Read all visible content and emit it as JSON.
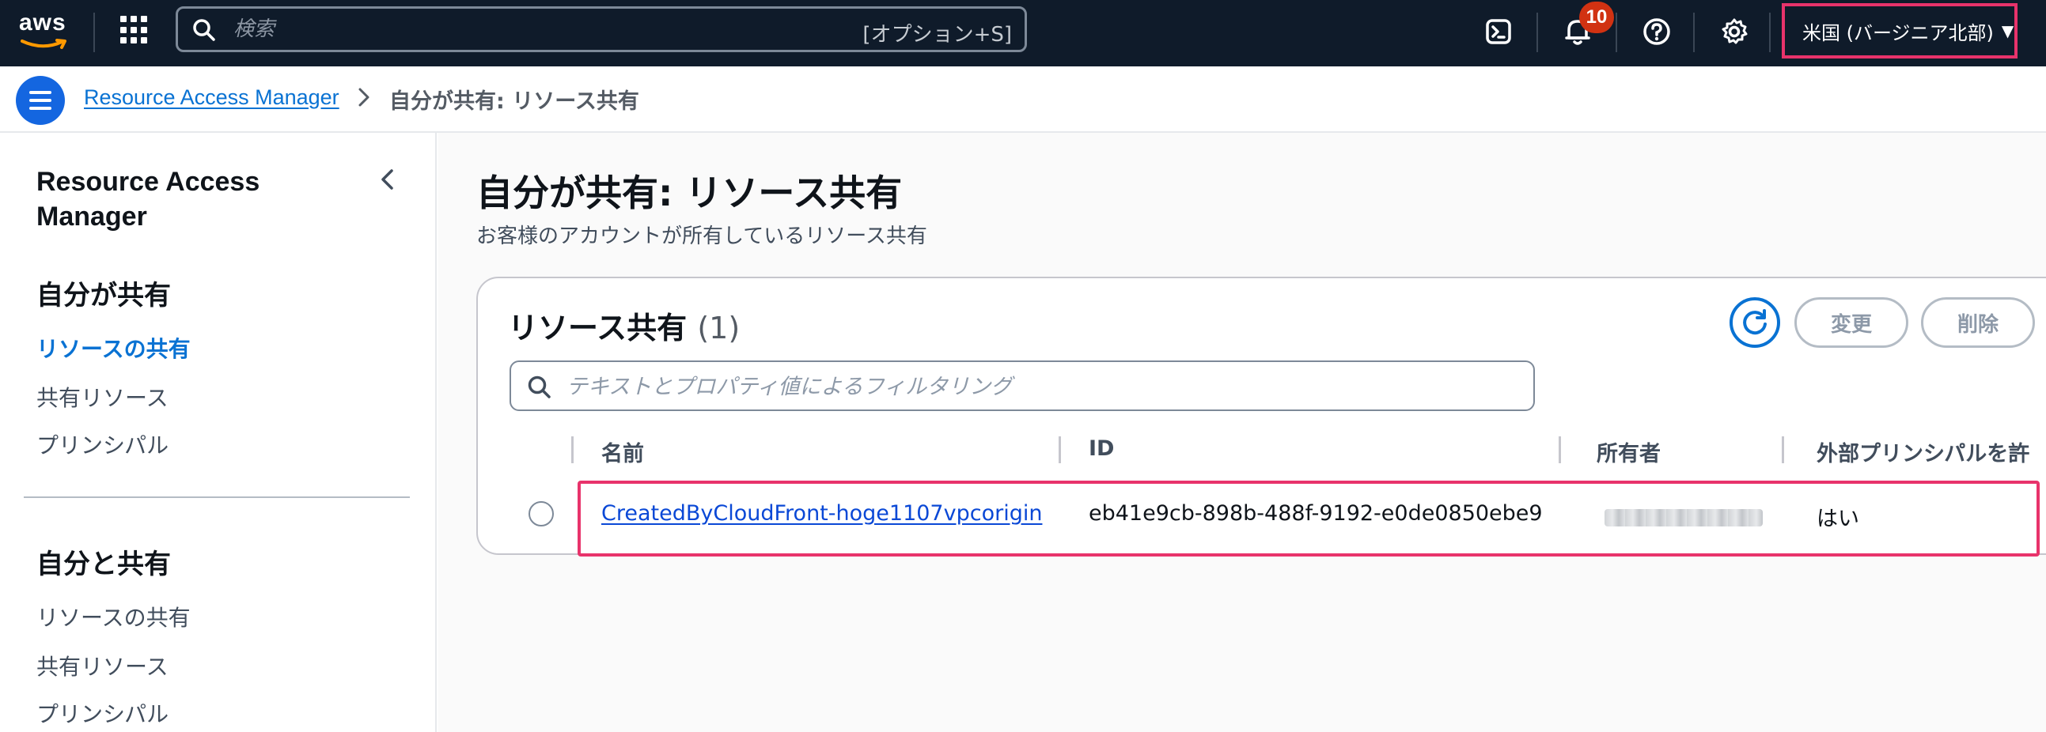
{
  "topnav": {
    "logo_text": "aws",
    "search": {
      "placeholder": "検索",
      "shortcut": "[オプション+S]"
    },
    "notifications_count": "10",
    "region": "米国 (バージニア北部)"
  },
  "breadcrumb": {
    "root": "Resource Access Manager",
    "current": "自分が共有: リソース共有"
  },
  "sidebar": {
    "title": "Resource Access Manager",
    "sections": [
      {
        "heading": "自分が共有",
        "items": [
          {
            "label": "リソースの共有",
            "active": true
          },
          {
            "label": "共有リソース",
            "active": false
          },
          {
            "label": "プリンシパル",
            "active": false
          }
        ]
      },
      {
        "heading": "自分と共有",
        "items": [
          {
            "label": "リソースの共有",
            "active": false
          },
          {
            "label": "共有リソース",
            "active": false
          },
          {
            "label": "プリンシパル",
            "active": false
          }
        ]
      }
    ]
  },
  "main": {
    "title": "自分が共有: リソース共有",
    "description": "お客様のアカウントが所有しているリソース共有",
    "panel": {
      "title": "リソース共有",
      "count": "(1)",
      "buttons": {
        "edit": "変更",
        "delete": "削除"
      },
      "filter_placeholder": "テキストとプロパティ値によるフィルタリング",
      "columns": [
        "名前",
        "ID",
        "所有者",
        "外部プリンシパルを許"
      ],
      "rows": [
        {
          "name": "CreatedByCloudFront-hoge1107vpcorigin",
          "id": "eb41e9cb-898b-488f-9192-e0de0850ebe9",
          "owner": "",
          "external": "はい"
        }
      ]
    }
  },
  "colors": {
    "accent": "#0972d3",
    "highlight": "#e8336b",
    "nav_bg": "#0f1b2a",
    "badge": "#d13212"
  }
}
